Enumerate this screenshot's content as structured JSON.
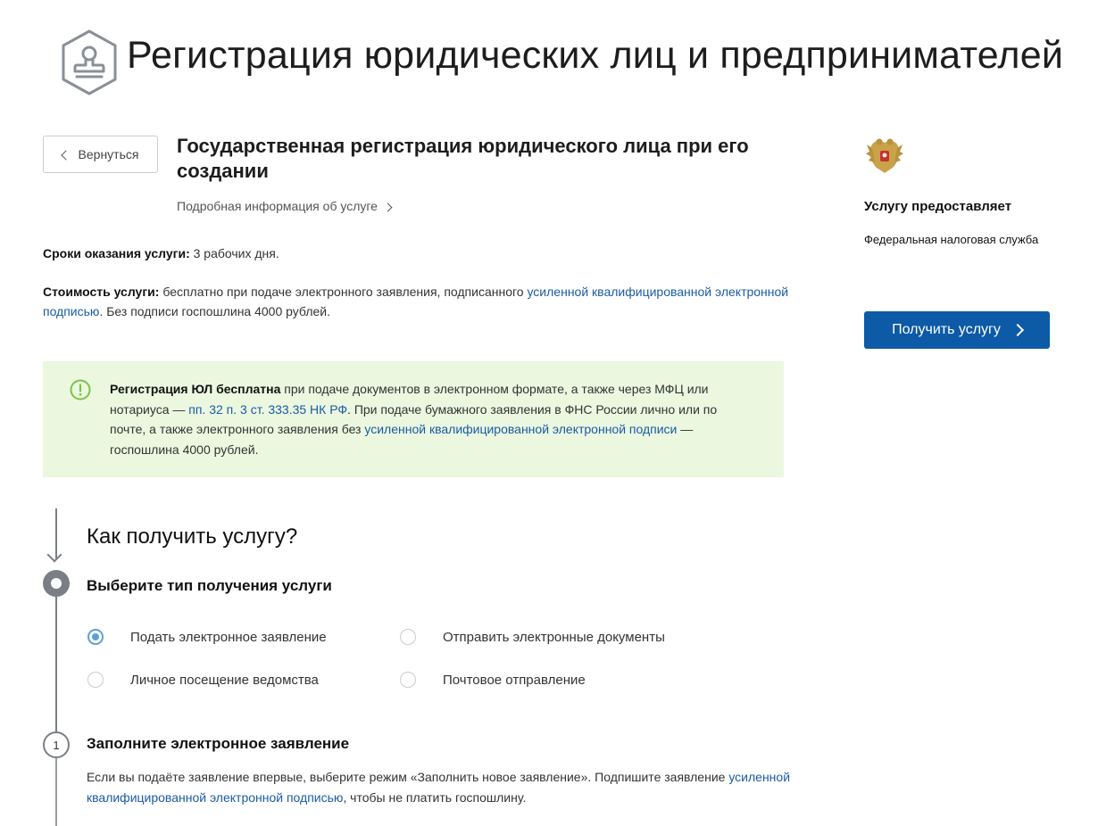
{
  "header": {
    "title": "Регистрация юридических лиц и предпринимателей",
    "logo_icon": "stamp-icon"
  },
  "nav": {
    "back_label": "Вернуться"
  },
  "service": {
    "title": "Государственная регистрация юридического лица при его создании",
    "more_info_label": "Подробная информация об услуге",
    "terms_label": "Сроки оказания услуги:",
    "terms_value": " 3 рабочих дня.",
    "cost_label": "Стоимость услуги:",
    "cost_text_1": " бесплатно при подаче электронного заявления, подписанного ",
    "cost_link": "усиленной квалифицированной электронной подписью",
    "cost_text_2": ". Без подписи госпошлина 4000 рублей."
  },
  "notice": {
    "icon": "exclamation-circle-icon",
    "bold": "Регистрация ЮЛ бесплатна",
    "text_1": " при подаче документов в электронном формате, а также через МФЦ или нотариуса — ",
    "link_1": "пп. 32 п. 3 ст. 333.35 НК РФ",
    "text_2": ". При подаче бумажного заявления в ФНС России лично или по почте, а также электронного заявления без ",
    "link_2": "усиленной квалифицированной электронной подписи",
    "text_3": " — госпошлина 4000 рублей.",
    "bg_color": "#ebf7df"
  },
  "provider": {
    "emblem_icon": "coat-of-arms-icon",
    "label": "Услугу предоставляет",
    "name": "Федеральная налоговая служба",
    "get_button": "Получить услугу",
    "button_color": "#0d5aa7"
  },
  "steps": {
    "how_title": "Как получить услугу?",
    "step1_title": "Выберите тип получения услуги",
    "options": [
      {
        "label": "Подать электронное заявление",
        "selected": true
      },
      {
        "label": "Отправить электронные документы",
        "selected": false
      },
      {
        "label": "Личное посещение ведомства",
        "selected": false
      },
      {
        "label": "Почтовое отправление",
        "selected": false
      }
    ],
    "step2_number": "1",
    "step2_title": "Заполните электронное заявление",
    "step2_text_1": "Если вы подаёте заявление впервые, выберите режим «Заполнить новое заявление». Подпишите заявление ",
    "step2_link": "усиленной квалифицированной электронной подписью",
    "step2_text_2": ", чтобы не платить госпошлину."
  }
}
